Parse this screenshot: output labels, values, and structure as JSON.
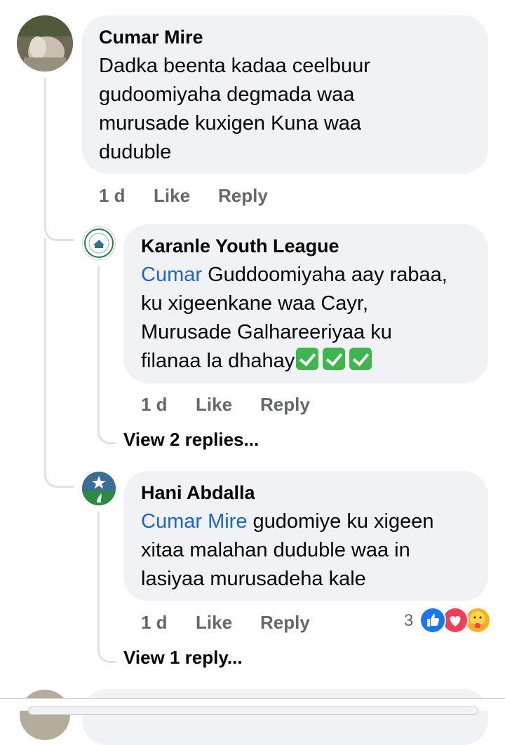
{
  "comments": [
    {
      "author": "Cumar Mire",
      "lines": [
        "Dadka beenta kadaa ceelbuur",
        "gudoomiyaha degmada waa",
        "murusade kuxigen Kuna waa",
        "duduble"
      ],
      "time": "1 d",
      "like": "Like",
      "reply": "Reply"
    },
    {
      "author": "Karanle Youth League",
      "mention": "Cumar",
      "line1_rest": " Guddoomiyaha aay rabaa,",
      "lines": [
        "ku xigeenkane waa Cayr,",
        "Murusade Galhareeriyaa ku"
      ],
      "last_line": "filanaa la dhahay",
      "time": "1 d",
      "like": "Like",
      "reply": "Reply",
      "view_replies": "View 2 replies..."
    },
    {
      "author": "Hani Abdalla",
      "mention": "Cumar Mire",
      "line1_rest": " gudomiye ku xigeen",
      "lines": [
        "xitaa malahan duduble waa in",
        "lasiyaa murusadeha kale"
      ],
      "time": "1 d",
      "like": "Like",
      "reply": "Reply",
      "reaction_count": "3",
      "reactions": [
        "like-icon",
        "love-icon",
        "care-icon"
      ],
      "view_replies": "View 1 reply..."
    }
  ],
  "colors": {
    "bubble": "#f0f2f5",
    "mention": "#1d64c4",
    "meta": "#65676b",
    "like_blue": "#1877f2",
    "love_red": "#f33e58"
  }
}
